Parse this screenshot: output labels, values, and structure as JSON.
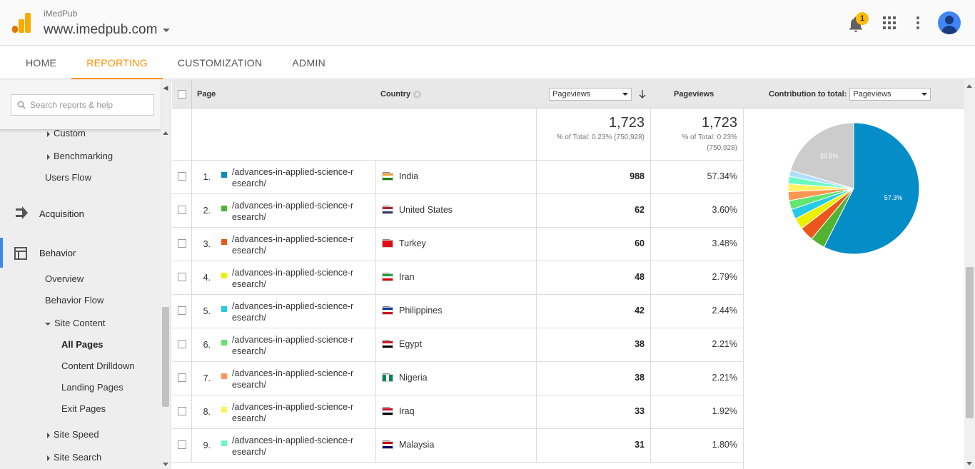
{
  "header": {
    "account": "iMedPub",
    "property": "www.imedpub.com",
    "notification_count": "1"
  },
  "tabs": [
    {
      "label": "HOME"
    },
    {
      "label": "REPORTING"
    },
    {
      "label": "CUSTOMIZATION"
    },
    {
      "label": "ADMIN"
    }
  ],
  "active_tab": "REPORTING",
  "sidebar": {
    "search_placeholder": "Search reports & help",
    "items": {
      "custom": "Custom",
      "benchmarking": "Benchmarking",
      "users_flow": "Users Flow",
      "acquisition": "Acquisition",
      "behavior": "Behavior",
      "overview": "Overview",
      "behavior_flow": "Behavior Flow",
      "site_content": "Site Content",
      "all_pages": "All Pages",
      "content_drilldown": "Content Drilldown",
      "landing_pages": "Landing Pages",
      "exit_pages": "Exit Pages",
      "site_speed": "Site Speed",
      "site_search": "Site Search"
    }
  },
  "table": {
    "headers": {
      "page": "Page",
      "country": "Country",
      "metric_select": "Pageviews",
      "metric_col": "Pageviews",
      "contribution_label": "Contribution to total:",
      "contribution_select": "Pageviews"
    },
    "totals": {
      "value1": "1,723",
      "sub1": "% of Total: 0.23% (750,928)",
      "value2": "1,723",
      "sub2a": "% of Total: 0.23%",
      "sub2b": "(750,928)"
    },
    "rows": [
      {
        "num": "1.",
        "page": "/advances-in-applied-science-research/",
        "country": "India",
        "pageviews": "988",
        "pct": "57.34%",
        "color": "#058dc7"
      },
      {
        "num": "2.",
        "page": "/advances-in-applied-science-research/",
        "country": "United States",
        "pageviews": "62",
        "pct": "3.60%",
        "color": "#50b432"
      },
      {
        "num": "3.",
        "page": "/advances-in-applied-science-research/",
        "country": "Turkey",
        "pageviews": "60",
        "pct": "3.48%",
        "color": "#ed561b"
      },
      {
        "num": "4.",
        "page": "/advances-in-applied-science-research/",
        "country": "Iran",
        "pageviews": "48",
        "pct": "2.79%",
        "color": "#edef00"
      },
      {
        "num": "5.",
        "page": "/advances-in-applied-science-research/",
        "country": "Philippines",
        "pageviews": "42",
        "pct": "2.44%",
        "color": "#24cbe5"
      },
      {
        "num": "6.",
        "page": "/advances-in-applied-science-research/",
        "country": "Egypt",
        "pageviews": "38",
        "pct": "2.21%",
        "color": "#64e572"
      },
      {
        "num": "7.",
        "page": "/advances-in-applied-science-research/",
        "country": "Nigeria",
        "pageviews": "38",
        "pct": "2.21%",
        "color": "#ff9655"
      },
      {
        "num": "8.",
        "page": "/advances-in-applied-science-research/",
        "country": "Iraq",
        "pageviews": "33",
        "pct": "1.92%",
        "color": "#fff263"
      },
      {
        "num": "9.",
        "page": "/advances-in-applied-science-research/",
        "country": "Malaysia",
        "pageviews": "31",
        "pct": "1.80%",
        "color": "#6af9c4"
      }
    ]
  },
  "chart_data": {
    "type": "pie",
    "slices": [
      {
        "label": "India",
        "value": 57.34,
        "color": "#058dc7"
      },
      {
        "label": "United States",
        "value": 3.6,
        "color": "#50b432"
      },
      {
        "label": "Turkey",
        "value": 3.48,
        "color": "#ed561b"
      },
      {
        "label": "Iran",
        "value": 2.79,
        "color": "#edef00"
      },
      {
        "label": "Philippines",
        "value": 2.44,
        "color": "#24cbe5"
      },
      {
        "label": "Egypt",
        "value": 2.21,
        "color": "#64e572"
      },
      {
        "label": "Nigeria",
        "value": 2.21,
        "color": "#ff9655"
      },
      {
        "label": "Iraq",
        "value": 1.92,
        "color": "#fff263"
      },
      {
        "label": "Malaysia",
        "value": 1.8,
        "color": "#6af9c4"
      },
      {
        "label": "",
        "value": 1.5,
        "color": "#b2deff"
      },
      {
        "label": "Other",
        "value": 20.5,
        "color": "#cccccc"
      }
    ],
    "data_labels": [
      "57.3%",
      "20.5%"
    ]
  }
}
